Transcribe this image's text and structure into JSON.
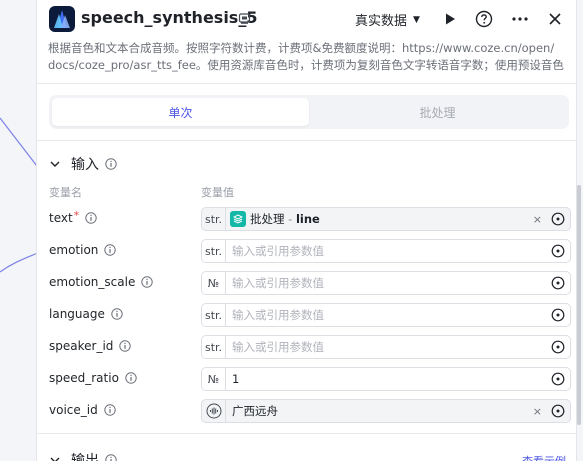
{
  "node": {
    "title": "speech_synthesis_5",
    "data_mode": "真实数据",
    "description_lines": [
      "根据音色和文本合成音频。按照字符数计费，计费项&免费额度说明：https://www.coze.cn/open/",
      "docs/coze_pro/asr_tts_fee。使用资源库音色时，计费项为复刻音色文字转语音字数；使用预设音色"
    ]
  },
  "tabs": [
    {
      "label": "单次",
      "active": true
    },
    {
      "label": "批处理",
      "active": false
    }
  ],
  "input_section": {
    "title": "输入",
    "col_name": "变量名",
    "col_value": "变量值",
    "params": [
      {
        "name": "text",
        "required": true,
        "type": "str.",
        "ref_label": "批处理",
        "ref_sep": " - ",
        "ref_field": "line"
      },
      {
        "name": "emotion",
        "type": "str.",
        "placeholder": "输入或引用参数值"
      },
      {
        "name": "emotion_scale",
        "type": "№",
        "placeholder": "输入或引用参数值"
      },
      {
        "name": "language",
        "type": "str.",
        "placeholder": "输入或引用参数值"
      },
      {
        "name": "speaker_id",
        "type": "str.",
        "placeholder": "输入或引用参数值"
      },
      {
        "name": "speed_ratio",
        "type": "№",
        "value": "1"
      },
      {
        "name": "voice_id",
        "voice_value": "广西远舟"
      }
    ],
    "required_mark": "*",
    "clear_symbol": "×"
  },
  "output_section": {
    "title": "输出",
    "example_link": "查看示例"
  },
  "colors": {
    "accent": "#4c57e6",
    "ref_icon": "#14b8a6",
    "required": "#e04a4a"
  }
}
